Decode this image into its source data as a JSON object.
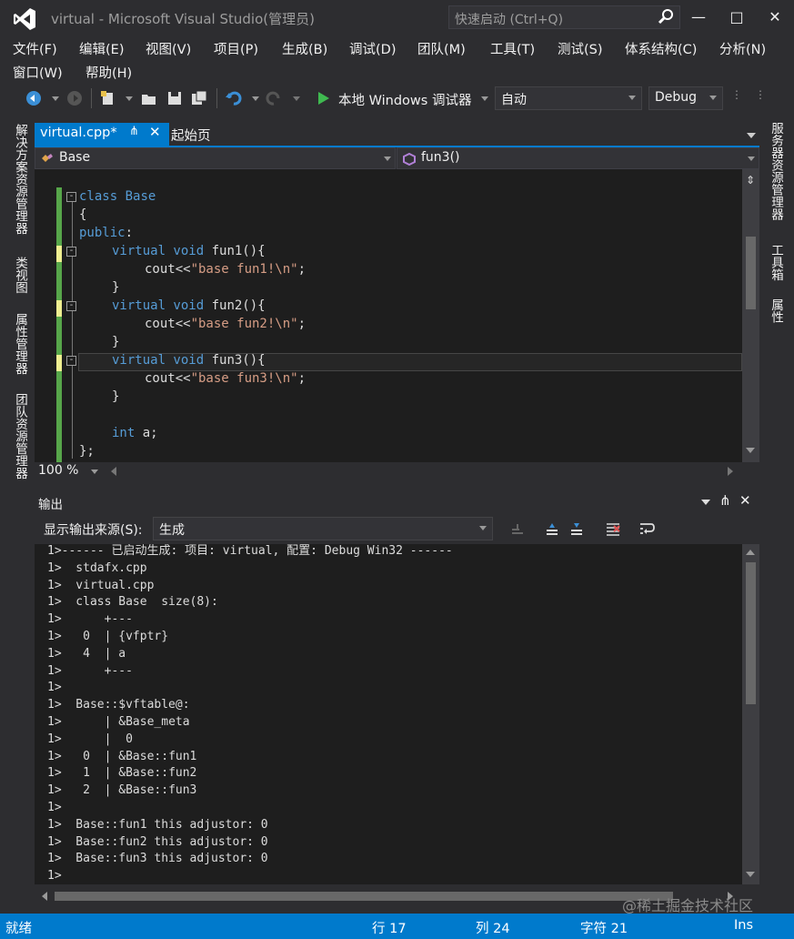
{
  "window": {
    "title": "virtual - Microsoft Visual Studio(管理员)",
    "quick_launch_placeholder": "快速启动 (Ctrl+Q)"
  },
  "menu": [
    "文件(F)",
    "编辑(E)",
    "视图(V)",
    "项目(P)",
    "生成(B)",
    "调试(D)",
    "团队(M)",
    "工具(T)",
    "测试(S)",
    "体系结构(C)",
    "分析(N)",
    "窗口(W)",
    "帮助(H)"
  ],
  "toolbar": {
    "run_label": "本地 Windows 调试器",
    "solution_platform": "自动",
    "config": "Debug"
  },
  "left_tabs": [
    "解决方案资源管理器",
    "类视图",
    "属性管理器",
    "团队资源管理器"
  ],
  "right_tabs": [
    "服务器资源管理器",
    "工具箱",
    "属性"
  ],
  "editor": {
    "tabs": [
      {
        "label": "virtual.cpp*",
        "active": true
      },
      {
        "label": "起始页",
        "active": false
      }
    ],
    "nav_class": "Base",
    "nav_member": "fun3()",
    "zoom": "100 %",
    "code": [
      {
        "kw": "class",
        "rest": " Base",
        "rest_kw": true
      },
      {
        "text": "{"
      },
      {
        "kw": "public",
        "rest": ":"
      },
      {
        "kw": "virtual void",
        "rest": " fun1(){",
        "indent": 1
      },
      {
        "text": "cout<<",
        "str": "\"base fun1!\\n\"",
        "tail": ";",
        "indent": 2
      },
      {
        "text": "}",
        "indent": 1
      },
      {
        "kw": "virtual void",
        "rest": " fun2(){",
        "indent": 1
      },
      {
        "text": "cout<<",
        "str": "\"base fun2!\\n\"",
        "tail": ";",
        "indent": 2
      },
      {
        "text": "}",
        "indent": 1
      },
      {
        "kw": "virtual void",
        "rest": " fun3(){",
        "indent": 1
      },
      {
        "text": "cout<<",
        "str": "\"base fun3!\\n\"",
        "tail": ";",
        "indent": 2
      },
      {
        "text": "}",
        "indent": 1
      },
      {
        "text": ""
      },
      {
        "kw": "int",
        "rest": " a;",
        "indent": 1
      },
      {
        "text": "};"
      }
    ]
  },
  "output": {
    "title": "输出",
    "source_label": "显示输出来源(S):",
    "source_value": "生成",
    "lines": [
      "1>------ 已启动生成: 项目: virtual, 配置: Debug Win32 ------",
      "1>  stdafx.cpp",
      "1>  virtual.cpp",
      "1>  class Base  size(8):",
      "1>  \t+---",
      "1>   0\t| {vfptr}",
      "1>   4\t| a",
      "1>  \t+---",
      "1>",
      "1>  Base::$vftable@:",
      "1>  \t| &Base_meta",
      "1>  \t|  0",
      "1>   0\t| &Base::fun1",
      "1>   1\t| &Base::fun2",
      "1>   2\t| &Base::fun3",
      "1>",
      "1>  Base::fun1 this adjustor: 0",
      "1>  Base::fun2 this adjustor: 0",
      "1>  Base::fun3 this adjustor: 0",
      "1>"
    ]
  },
  "status": {
    "ready": "就绪",
    "line": "行 17",
    "col": "列 24",
    "char": "字符 21",
    "mode": "Ins"
  },
  "watermark": "@稀土掘金技术社区",
  "colors": {
    "accent": "#007acc",
    "keyword": "#569cd6",
    "string": "#d69d85",
    "bg": "#2d2d30",
    "editor_bg": "#1e1e1e"
  }
}
